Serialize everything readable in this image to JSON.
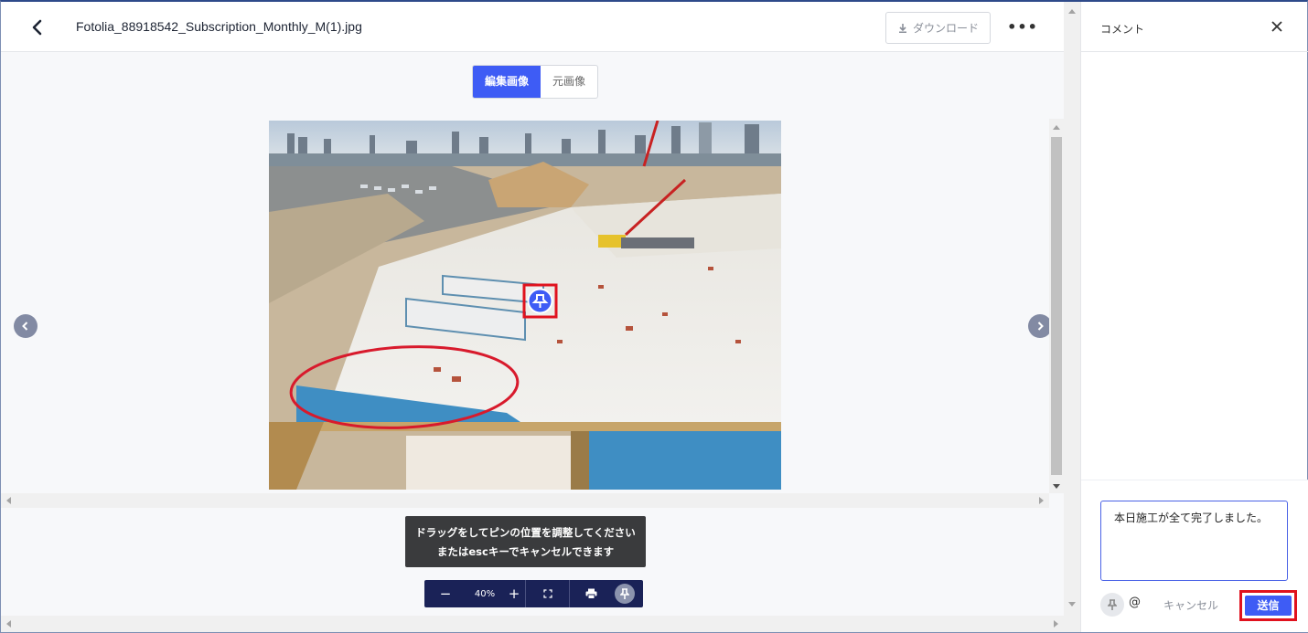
{
  "header": {
    "filename": "Fotolia_88918542_Subscription_Monthly_M(1).jpg",
    "download_label": "ダウンロード",
    "more_label": "•••"
  },
  "view_toggle": {
    "edited_label": "編集画像",
    "original_label": "元画像",
    "selected": "編集画像"
  },
  "tooltip": {
    "line1": "ドラッグをしてピンの位置を調整してください",
    "line2": "またはescキーでキャンセルできます"
  },
  "zoom": {
    "minus": "−",
    "value": "40%",
    "plus": "+"
  },
  "comments": {
    "title": "コメント",
    "input_value": "本日施工が全て完了しました。",
    "at_label": "@",
    "cancel_label": "キャンセル",
    "send_label": "送信"
  },
  "colors": {
    "accent": "#3e5cf5",
    "highlight_red": "#e0121e",
    "zoom_bar": "#1a2257",
    "tooltip_bg": "#3a3b3d"
  },
  "icons": [
    "back-chevron-icon",
    "download-icon",
    "more-icon",
    "prev-arrow-icon",
    "next-arrow-icon",
    "fit-screen-icon",
    "print-icon",
    "pin-icon",
    "close-icon"
  ]
}
